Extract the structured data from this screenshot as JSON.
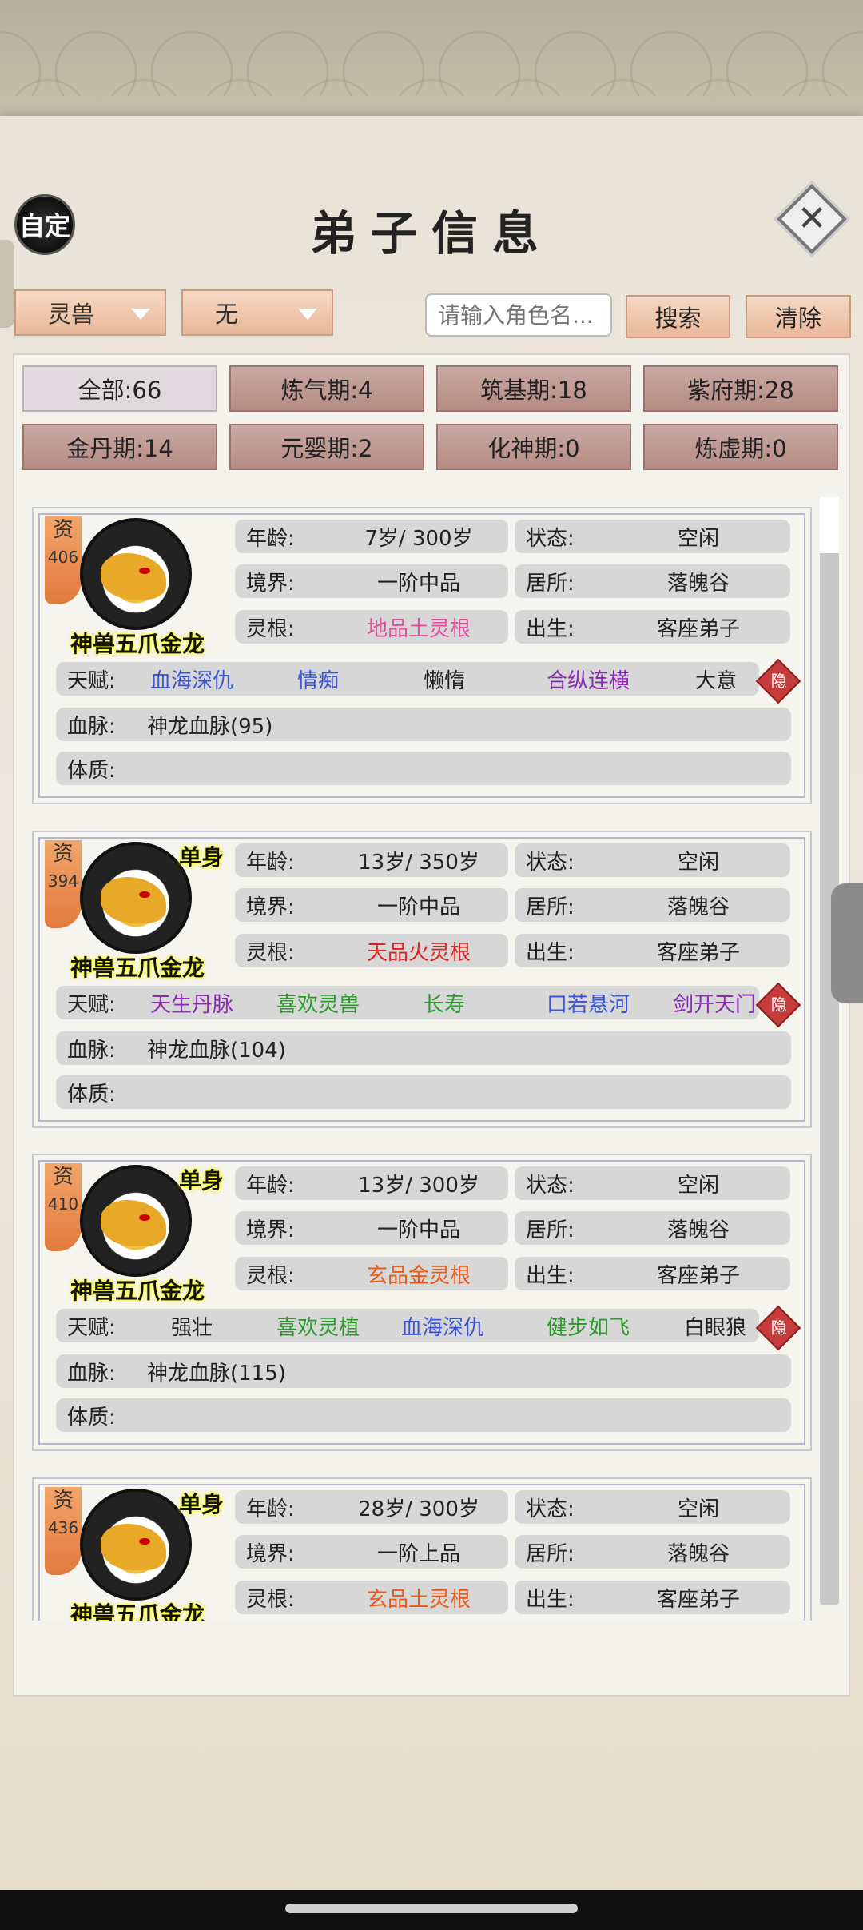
{
  "header": {
    "auto_label": "自定",
    "title": "弟子信息"
  },
  "filters": {
    "type_select": "灵兽",
    "sub_select": "无",
    "search_placeholder": "请输入角色名...",
    "search_label": "搜索",
    "clear_label": "清除"
  },
  "realms": [
    {
      "label": "全部:66"
    },
    {
      "label": "炼气期:4"
    },
    {
      "label": "筑基期:18"
    },
    {
      "label": "紫府期:28"
    },
    {
      "label": "金丹期:14"
    },
    {
      "label": "元婴期:2"
    },
    {
      "label": "化神期:0"
    },
    {
      "label": "炼虚期:0"
    }
  ],
  "labels": {
    "age": "年龄:",
    "status": "状态:",
    "realm": "境界:",
    "residence": "居所:",
    "root": "灵根:",
    "birth": "出生:",
    "talent": "天赋:",
    "bloodline": "血脉:",
    "physique": "体质:",
    "zi": "资",
    "hide": "隐"
  },
  "disciples": [
    {
      "zi_num": "406",
      "single": "",
      "name": "神兽五爪金龙",
      "age": "7岁/ 300岁",
      "status": "空闲",
      "realm": "一阶中品",
      "residence": "落魄谷",
      "root": "地品土灵根",
      "root_color": "pink",
      "birth": "客座弟子",
      "talents": [
        {
          "text": "血海深仇",
          "color": "blue"
        },
        {
          "text": "情痴",
          "color": "blue"
        },
        {
          "text": "懒惰",
          "color": "black"
        },
        {
          "text": "合纵连横",
          "color": "purple"
        },
        {
          "text": "大意",
          "color": "black"
        }
      ],
      "bloodline": "神龙血脉(95)",
      "physique": ""
    },
    {
      "zi_num": "394",
      "single": "单身",
      "name": "神兽五爪金龙",
      "age": "13岁/ 350岁",
      "status": "空闲",
      "realm": "一阶中品",
      "residence": "落魄谷",
      "root": "天品火灵根",
      "root_color": "red",
      "birth": "客座弟子",
      "talents": [
        {
          "text": "天生丹脉",
          "color": "purple"
        },
        {
          "text": "喜欢灵兽",
          "color": "green"
        },
        {
          "text": "长寿",
          "color": "green"
        },
        {
          "text": "口若悬河",
          "color": "blue"
        },
        {
          "text": "剑开天门",
          "color": "purple"
        }
      ],
      "bloodline": "神龙血脉(104)",
      "physique": ""
    },
    {
      "zi_num": "410",
      "single": "单身",
      "name": "神兽五爪金龙",
      "age": "13岁/ 300岁",
      "status": "空闲",
      "realm": "一阶中品",
      "residence": "落魄谷",
      "root": "玄品金灵根",
      "root_color": "orange",
      "birth": "客座弟子",
      "talents": [
        {
          "text": "强壮",
          "color": "black"
        },
        {
          "text": "喜欢灵植",
          "color": "green"
        },
        {
          "text": "血海深仇",
          "color": "blue"
        },
        {
          "text": "健步如飞",
          "color": "green"
        },
        {
          "text": "白眼狼",
          "color": "black"
        }
      ],
      "bloodline": "神龙血脉(115)",
      "physique": ""
    },
    {
      "zi_num": "436",
      "single": "单身",
      "name": "神兽五爪金龙",
      "age": "28岁/ 300岁",
      "status": "空闲",
      "realm": "一阶上品",
      "residence": "落魄谷",
      "root": "玄品土灵根",
      "root_color": "orange",
      "birth": "客座弟子",
      "talents": [],
      "bloodline": "",
      "physique": ""
    }
  ]
}
